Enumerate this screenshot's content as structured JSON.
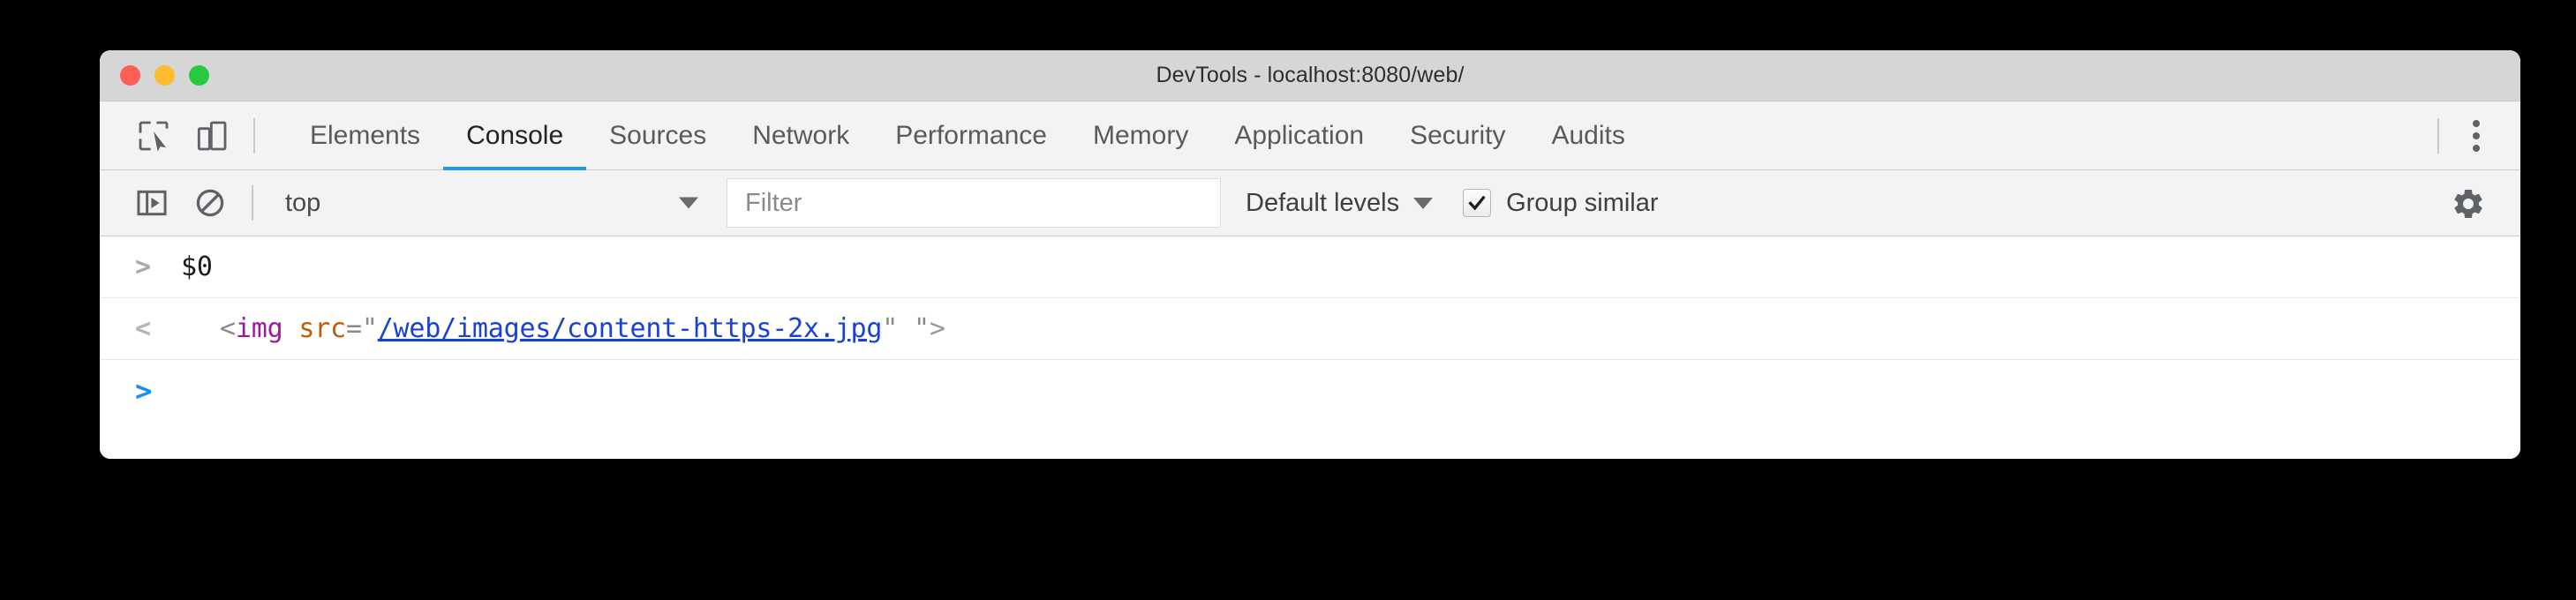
{
  "window": {
    "title": "DevTools - localhost:8080/web/",
    "traffic_lights": [
      {
        "name": "close",
        "color": "#ff5f56"
      },
      {
        "name": "minimize",
        "color": "#ffbd2e"
      },
      {
        "name": "zoom",
        "color": "#27c93f"
      }
    ]
  },
  "toolbar_icons": {
    "inspect": "inspect-element-icon",
    "device": "device-toolbar-icon",
    "kebab": "more-options-icon"
  },
  "tabs": [
    {
      "label": "Elements",
      "active": false
    },
    {
      "label": "Console",
      "active": true
    },
    {
      "label": "Sources",
      "active": false
    },
    {
      "label": "Network",
      "active": false
    },
    {
      "label": "Performance",
      "active": false
    },
    {
      "label": "Memory",
      "active": false
    },
    {
      "label": "Application",
      "active": false
    },
    {
      "label": "Security",
      "active": false
    },
    {
      "label": "Audits",
      "active": false
    }
  ],
  "console_toolbar": {
    "sidebar_toggle_icon": "console-sidebar-icon",
    "clear_icon": "clear-console-icon",
    "context": "top",
    "context_caret": "chevron-down-icon",
    "filter_placeholder": "Filter",
    "filter_value": "",
    "levels_label": "Default levels",
    "levels_caret": "chevron-down-icon",
    "group_similar_label": "Group similar",
    "group_similar_checked": true,
    "settings_icon": "gear-icon"
  },
  "console_messages": [
    {
      "type": "input",
      "prompt": ">",
      "text": "$0"
    },
    {
      "type": "output",
      "prompt": "<",
      "tokens": [
        {
          "kind": "punc",
          "text": "<"
        },
        {
          "kind": "tag",
          "text": "img"
        },
        {
          "kind": "punc",
          "text": " "
        },
        {
          "kind": "attr",
          "text": "src"
        },
        {
          "kind": "punc",
          "text": "="
        },
        {
          "kind": "quote",
          "text": "\""
        },
        {
          "kind": "url",
          "text": "/web/images/content-https-2x.jpg"
        },
        {
          "kind": "quote",
          "text": "\""
        },
        {
          "kind": "punc",
          "text": " "
        },
        {
          "kind": "quote",
          "text": "\""
        },
        {
          "kind": "gt",
          "text": ">"
        }
      ]
    },
    {
      "type": "prompt",
      "prompt": ">",
      "text": ""
    }
  ],
  "colors": {
    "accent": "#1a9bf0",
    "titlebar": "#d6d6d6",
    "toolbar": "#f3f3f3",
    "tag": "#a018a0",
    "attr": "#c25a00",
    "url": "#1a41d6",
    "prompt_blue": "#1a8cf0"
  }
}
